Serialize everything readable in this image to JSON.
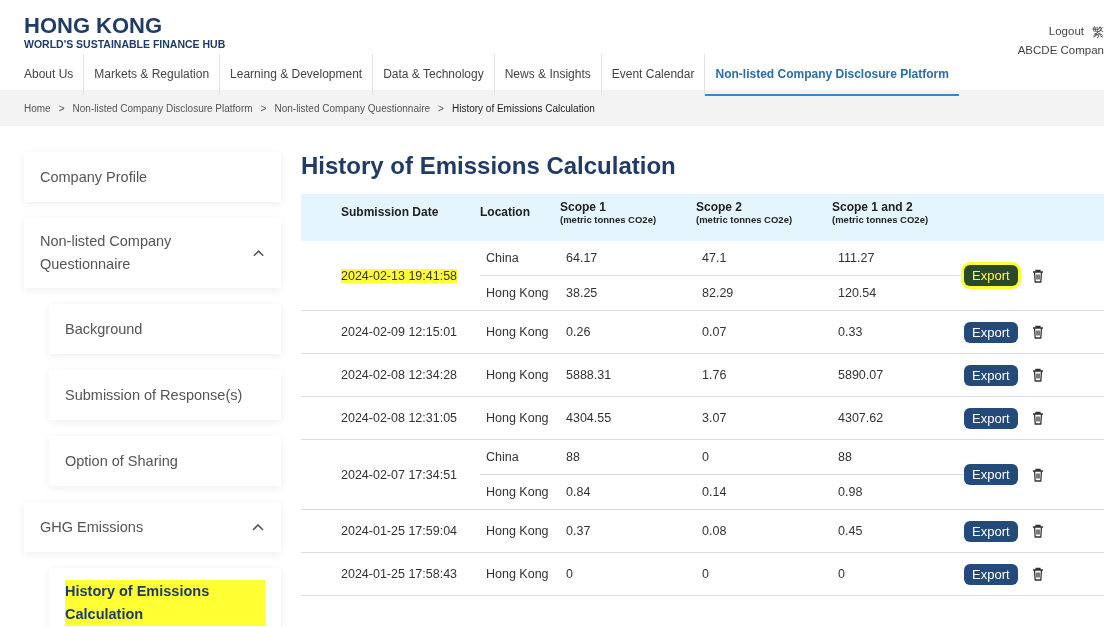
{
  "brand": {
    "title": "HONG KONG",
    "subtitle": "WORLD'S SUSTAINABLE FINANCE HUB"
  },
  "user_links": {
    "logout": "Logout",
    "language": "繁",
    "company": "ABCDE Compan"
  },
  "nav": [
    {
      "label": "About Us",
      "selected": false
    },
    {
      "label": "Markets & Regulation",
      "selected": false
    },
    {
      "label": "Learning & Development",
      "selected": false
    },
    {
      "label": "Data & Technology",
      "selected": false
    },
    {
      "label": "News & Insights",
      "selected": false
    },
    {
      "label": "Event Calendar",
      "selected": false
    },
    {
      "label": "Non-listed Company Disclosure Platform",
      "selected": true
    }
  ],
  "breadcrumb": [
    {
      "label": "Home"
    },
    {
      "separator": ">",
      "label": "Non-listed Company Disclosure Platform"
    },
    {
      "separator": ">",
      "label": "Non-listed Company Questionnaire"
    },
    {
      "separator": ">",
      "label": "History of Emissions Calculation"
    }
  ],
  "sidebar": {
    "items": [
      {
        "label": "Company Profile",
        "selected": false,
        "highlighted": false
      },
      {
        "label": "Non-listed Company Questionnaire",
        "selected": false,
        "highlighted": false,
        "expanded": true,
        "children": [
          {
            "label": "Background",
            "selected": false,
            "highlighted": false
          },
          {
            "label": "Submission of Response(s)",
            "selected": false,
            "highlighted": false
          },
          {
            "label": "Option of Sharing",
            "selected": false,
            "highlighted": false
          }
        ]
      },
      {
        "label": "GHG Emissions",
        "selected": false,
        "highlighted": false,
        "expanded": true,
        "children": [
          {
            "label": "History of Emissions Calculation",
            "selected": true,
            "highlighted": true
          }
        ]
      }
    ]
  },
  "page_title": "History of Emissions Calculation",
  "table": {
    "columns": [
      {
        "title": "Submission Date"
      },
      {
        "title": "Location"
      },
      {
        "title": "Scope 1",
        "unit": "(metric tonnes CO2e)"
      },
      {
        "title": "Scope 2",
        "unit": "(metric tonnes CO2e)"
      },
      {
        "title": "Scope 1 and 2",
        "unit": "(metric tonnes CO2e)"
      }
    ],
    "rows": [
      {
        "date": "2024-02-13 19:41:58",
        "highlighted": true,
        "export": "Export",
        "locations": [
          {
            "location": "China",
            "scope1": "64.17",
            "scope2": "47.1",
            "total": "111.27"
          },
          {
            "location": "Hong Kong",
            "scope1": "38.25",
            "scope2": "82.29",
            "total": "120.54"
          }
        ]
      },
      {
        "date": "2024-02-09 12:15:01",
        "highlighted": false,
        "export": "Export",
        "locations": [
          {
            "location": "Hong Kong",
            "scope1": "0.26",
            "scope2": "0.07",
            "total": "0.33"
          }
        ]
      },
      {
        "date": "2024-02-08 12:34:28",
        "highlighted": false,
        "export": "Export",
        "locations": [
          {
            "location": "Hong Kong",
            "scope1": "5888.31",
            "scope2": "1.76",
            "total": "5890.07"
          }
        ]
      },
      {
        "date": "2024-02-08 12:31:05",
        "highlighted": false,
        "export": "Export",
        "locations": [
          {
            "location": "Hong Kong",
            "scope1": "4304.55",
            "scope2": "3.07",
            "total": "4307.62"
          }
        ]
      },
      {
        "date": "2024-02-07 17:34:51",
        "highlighted": false,
        "export": "Export",
        "locations": [
          {
            "location": "China",
            "scope1": "88",
            "scope2": "0",
            "total": "88"
          },
          {
            "location": "Hong Kong",
            "scope1": "0.84",
            "scope2": "0.14",
            "total": "0.98"
          }
        ]
      },
      {
        "date": "2024-01-25 17:59:04",
        "highlighted": false,
        "export": "Export",
        "locations": [
          {
            "location": "Hong Kong",
            "scope1": "0.37",
            "scope2": "0.08",
            "total": "0.45"
          }
        ]
      },
      {
        "date": "2024-01-25 17:58:43",
        "highlighted": false,
        "export": "Export",
        "locations": [
          {
            "location": "Hong Kong",
            "scope1": "0",
            "scope2": "0",
            "total": "0"
          }
        ]
      }
    ]
  }
}
